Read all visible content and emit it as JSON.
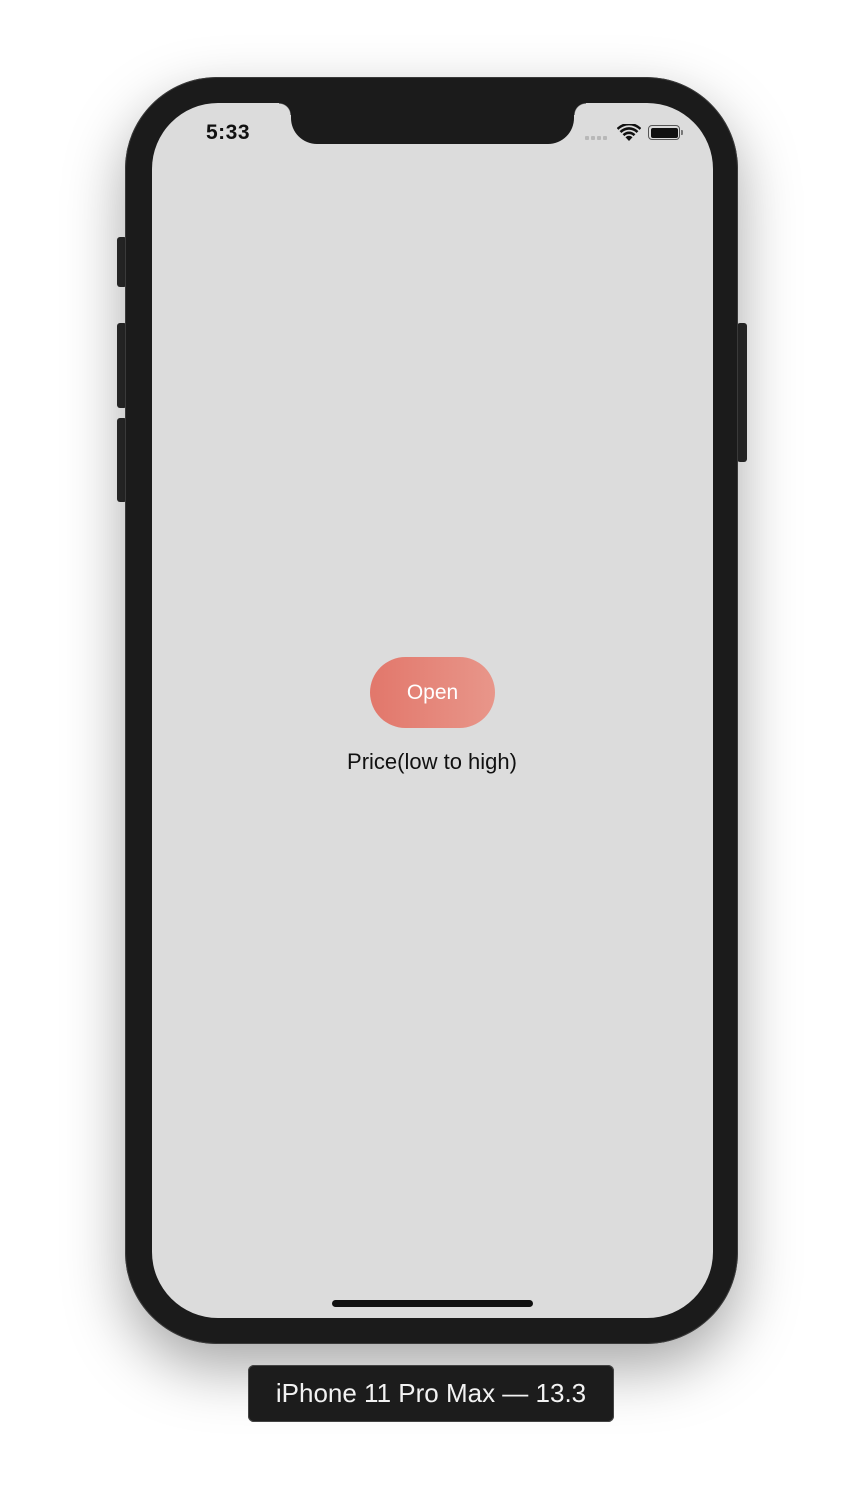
{
  "status_bar": {
    "time": "5:33",
    "signal_icon": "cellular-signal-icon",
    "wifi_icon": "wifi-icon",
    "battery_icon": "battery-icon",
    "battery_level": 1.0
  },
  "main": {
    "open_button_label": "Open",
    "sort_label": "Price(low to high)",
    "button_gradient": [
      "#e2776b",
      "#e8968a"
    ],
    "screen_background": "#dcdcdc"
  },
  "simulator": {
    "device_label": "iPhone 11 Pro Max — 13.3"
  }
}
